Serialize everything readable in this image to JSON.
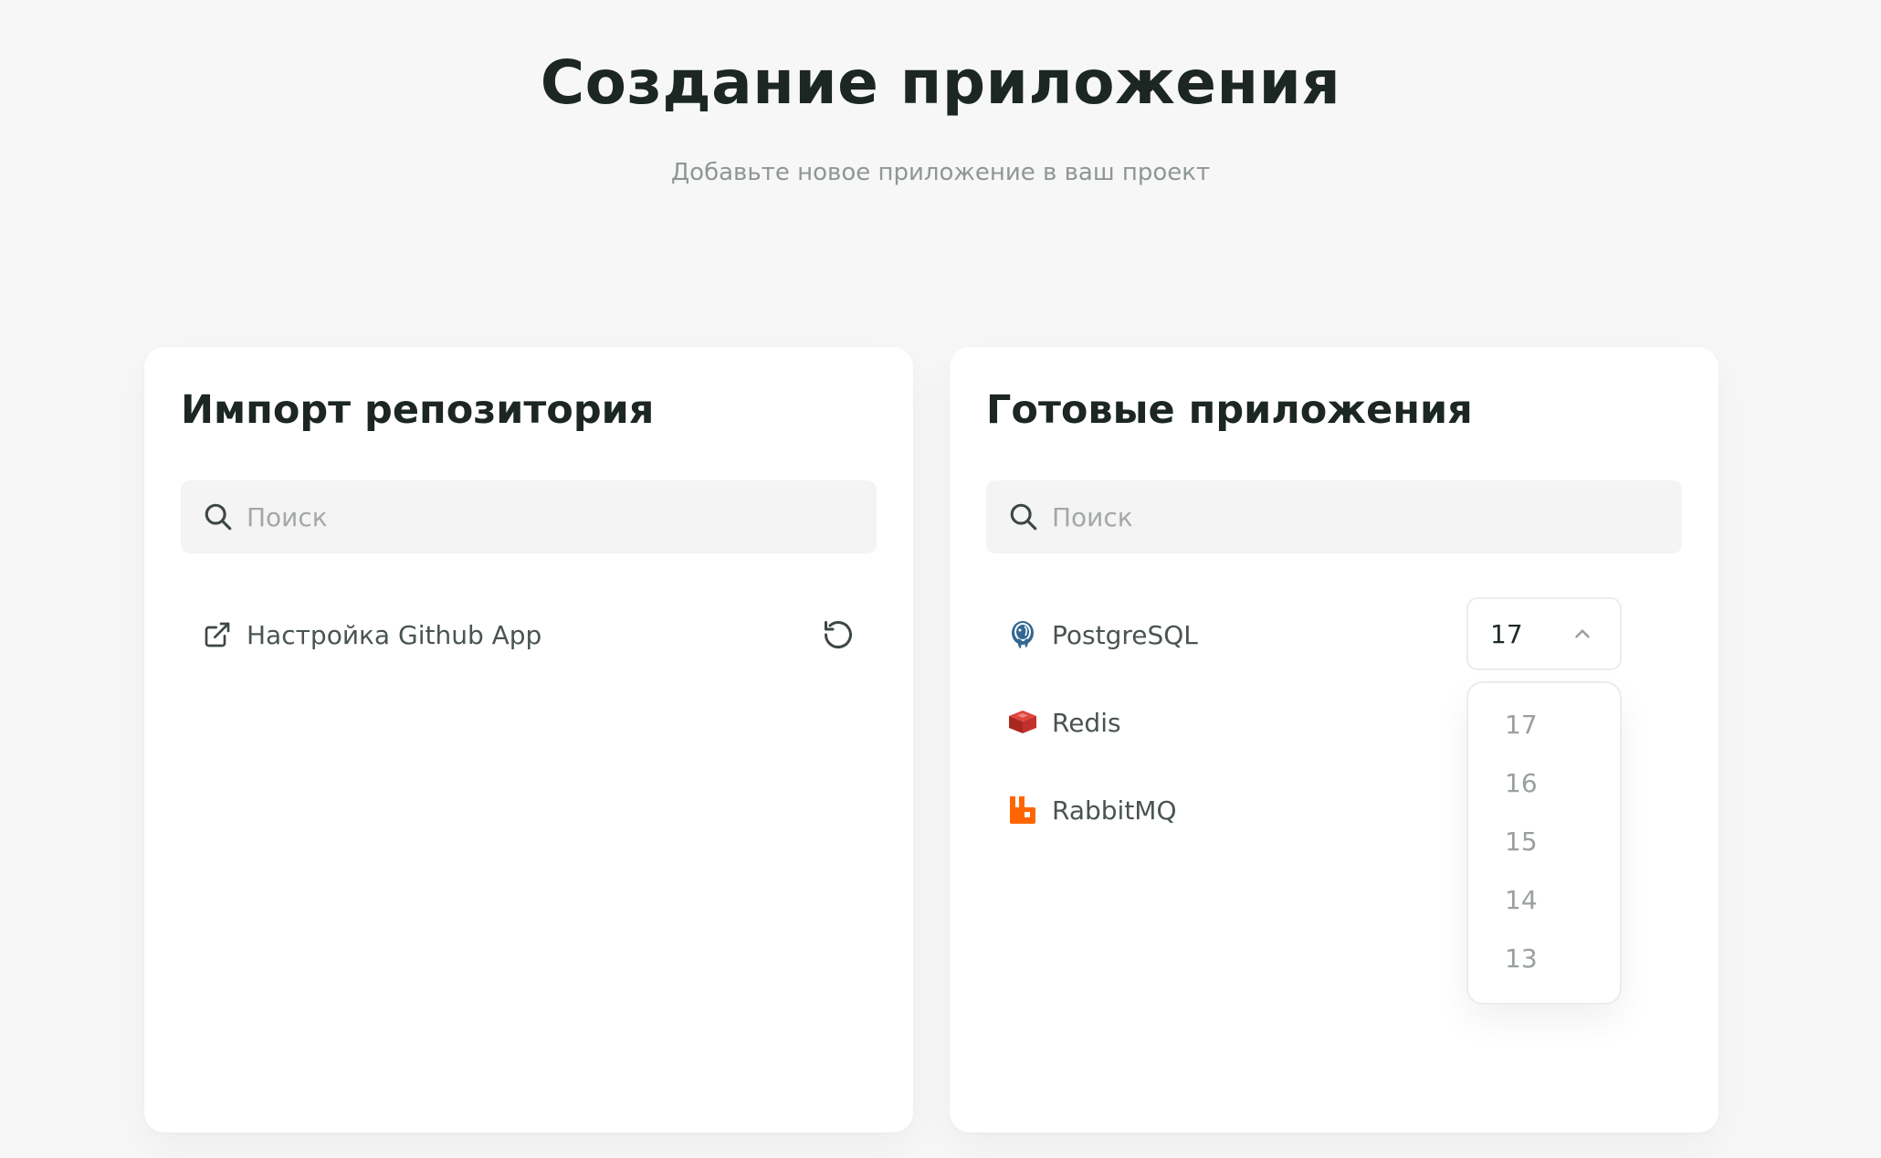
{
  "page": {
    "title": "Создание приложения",
    "subtitle": "Добавьте новое приложение в ваш проект"
  },
  "import_card": {
    "title": "Импорт репозитория",
    "search_placeholder": "Поиск",
    "github_link_label": "Настройка Github App"
  },
  "apps_card": {
    "title": "Готовые приложения",
    "search_placeholder": "Поиск",
    "apps": [
      {
        "label": "PostgreSQL",
        "icon": "postgresql-icon"
      },
      {
        "label": "Redis",
        "icon": "redis-icon"
      },
      {
        "label": "RabbitMQ",
        "icon": "rabbitmq-icon"
      }
    ],
    "version_select": {
      "selected": "17",
      "options": [
        "17",
        "16",
        "15",
        "14",
        "13"
      ]
    }
  },
  "colors": {
    "background": "#f7f7f7",
    "card": "#ffffff",
    "title_text": "#1c2623",
    "redis": "#c4302b",
    "rabbitmq": "#ff6600",
    "postgres": "#336791"
  }
}
